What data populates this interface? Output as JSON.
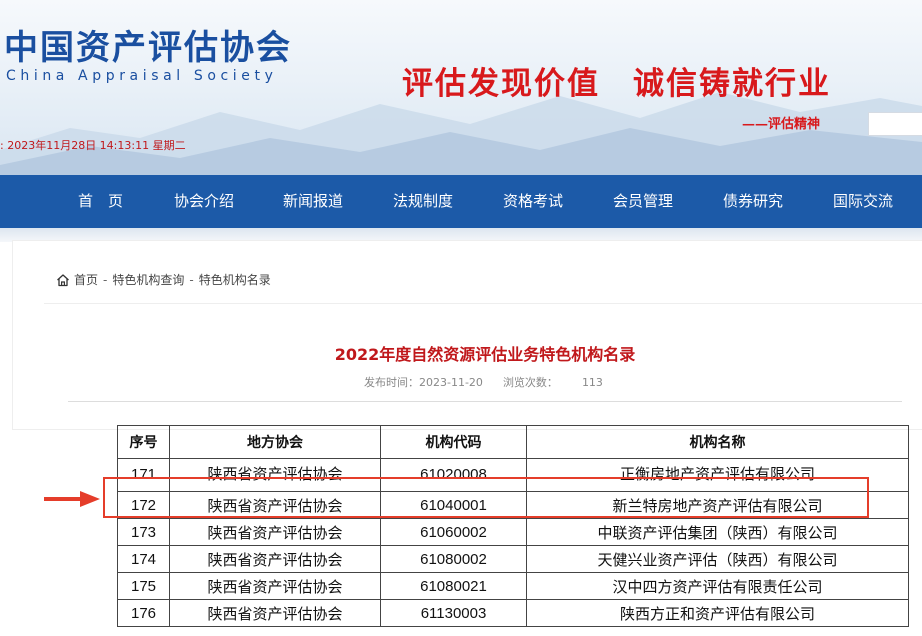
{
  "header": {
    "logo_cn": "中国资产评估协会",
    "logo_en": "China Appraisal Society",
    "slogan": "评估发现价值　诚信铸就行业",
    "slogan_sub": "——评估精神",
    "datetime": ": 2023年11月28日 14:13:11 星期二"
  },
  "nav": {
    "items": [
      "首　页",
      "协会介绍",
      "新闻报道",
      "法规制度",
      "资格考试",
      "会员管理",
      "债券研究",
      "国际交流"
    ]
  },
  "breadcrumb": {
    "home": "首页",
    "sep": "-",
    "level1": "特色机构查询",
    "level2": "特色机构名录"
  },
  "article": {
    "title": "2022年度自然资源评估业务特色机构名录",
    "publish_label": "发布时间：",
    "publish_date": "2023-11-20",
    "views_label": "浏览次数：",
    "views": "113"
  },
  "table": {
    "headers": [
      "序号",
      "地方协会",
      "机构代码",
      "机构名称"
    ],
    "rows": [
      [
        "171",
        "陕西省资产评估协会",
        "61020008",
        "正衡房地产资产评估有限公司"
      ],
      [
        "172",
        "陕西省资产评估协会",
        "61040001",
        "新兰特房地产资产评估有限公司"
      ],
      [
        "173",
        "陕西省资产评估协会",
        "61060002",
        "中联资产评估集团（陕西）有限公司"
      ],
      [
        "174",
        "陕西省资产评估协会",
        "61080002",
        "天健兴业资产评估（陕西）有限公司"
      ],
      [
        "175",
        "陕西省资产评估协会",
        "61080021",
        "汉中四方资产评估有限责任公司"
      ],
      [
        "176",
        "陕西省资产评估协会",
        "61130003",
        "陕西方正和资产评估有限公司"
      ]
    ]
  },
  "colors": {
    "brand_blue": "#1c5aa8",
    "accent_red": "#d8191c",
    "annotation_red": "#e53d2a"
  }
}
